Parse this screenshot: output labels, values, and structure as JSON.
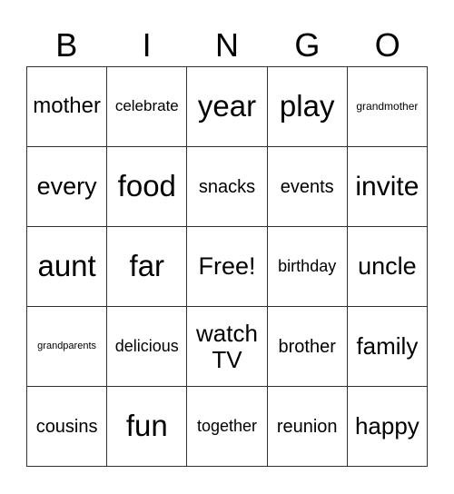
{
  "header": [
    "B",
    "I",
    "N",
    "G",
    "O"
  ],
  "cells": [
    [
      "mother",
      "celebrate",
      "year",
      "play",
      "grandmother"
    ],
    [
      "every",
      "food",
      "snacks",
      "events",
      "invite"
    ],
    [
      "aunt",
      "far",
      "Free!",
      "birthday",
      "uncle"
    ],
    [
      "grandparents",
      "delicious",
      "watch TV",
      "brother",
      "family"
    ],
    [
      "cousins",
      "fun",
      "together",
      "reunion",
      "happy"
    ]
  ]
}
